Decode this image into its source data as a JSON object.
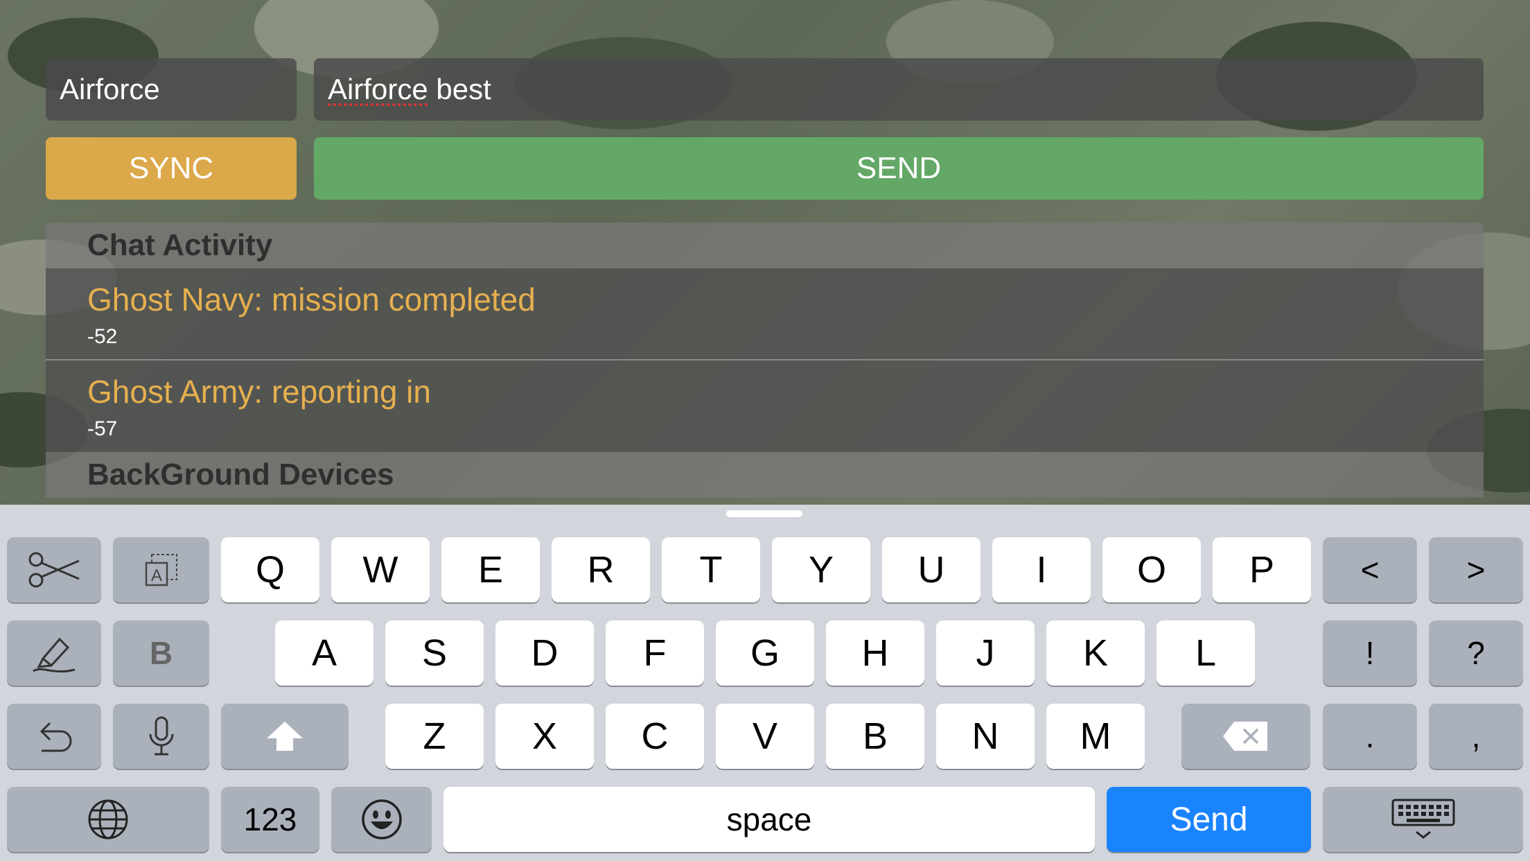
{
  "form": {
    "name_value": "Airforce",
    "message_prefix": "Airforce",
    "message_suffix": " best",
    "sync_label": "SYNC",
    "send_label": "SEND"
  },
  "chat": {
    "header": "Chat Activity",
    "items": [
      {
        "text": "Ghost Navy: mission completed",
        "signal": "-52"
      },
      {
        "text": "Ghost Army: reporting in",
        "signal": "-57"
      }
    ]
  },
  "background": {
    "header": "BackGround Devices"
  },
  "keyboard": {
    "row1": [
      "Q",
      "W",
      "E",
      "R",
      "T",
      "Y",
      "U",
      "I",
      "O",
      "P"
    ],
    "row2": [
      "A",
      "S",
      "D",
      "F",
      "G",
      "H",
      "J",
      "K",
      "L"
    ],
    "row3": [
      "Z",
      "X",
      "C",
      "V",
      "B",
      "N",
      "M"
    ],
    "left_arrow": "<",
    "right_arrow": ">",
    "bold": "B",
    "exclaim": "!",
    "question": "?",
    "period": ".",
    "comma": ",",
    "numbers": "123",
    "space": "space",
    "return": "Send"
  },
  "colors": {
    "sync": "#dca94a",
    "send": "#63a866",
    "chat_text": "#e6b04f",
    "return_key": "#1a84ff"
  },
  "icons": [
    "scissors-icon",
    "paste-icon",
    "marker-icon",
    "undo-icon",
    "microphone-icon",
    "shift-icon",
    "backspace-icon",
    "globe-icon",
    "emoji-icon",
    "dismiss-keyboard-icon"
  ]
}
